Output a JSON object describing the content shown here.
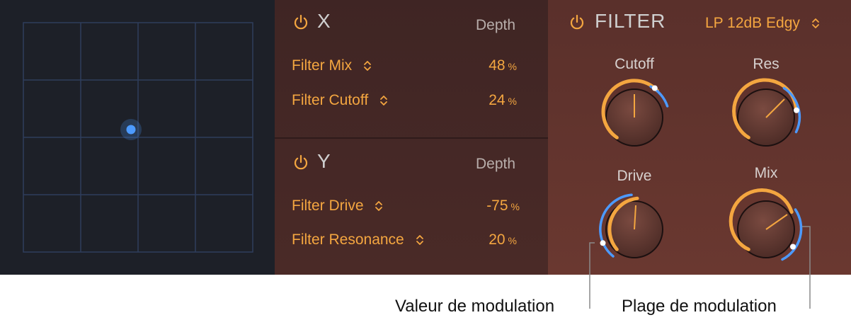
{
  "colors": {
    "xy_bg": "#1d2028",
    "grid_line": "#2f3d5c",
    "puck": "#4c9aff",
    "accent_orange": "#f4a640",
    "accent_blue": "#4c9aff",
    "mod_bg": "#44282 6",
    "filter_bg": "#62342e"
  },
  "x_section": {
    "title": "X",
    "depth_label": "Depth",
    "params": [
      {
        "name": "Filter Mix",
        "value": "48",
        "unit": "%"
      },
      {
        "name": "Filter Cutoff",
        "value": "24",
        "unit": "%"
      }
    ]
  },
  "y_section": {
    "title": "Y",
    "depth_label": "Depth",
    "params": [
      {
        "name": "Filter Drive",
        "value": "-75",
        "unit": "%"
      },
      {
        "name": "Filter Resonance",
        "value": "20",
        "unit": "%"
      }
    ]
  },
  "filter": {
    "title": "FILTER",
    "type": "LP 12dB Edgy",
    "knobs": [
      {
        "label": "Cutoff"
      },
      {
        "label": "Res"
      },
      {
        "label": "Drive"
      },
      {
        "label": "Mix"
      }
    ]
  },
  "callouts": {
    "modulation_value": "Valeur de modulation",
    "modulation_range": "Plage de modulation"
  },
  "icons": [
    "power-icon",
    "chevron-updown-icon"
  ]
}
